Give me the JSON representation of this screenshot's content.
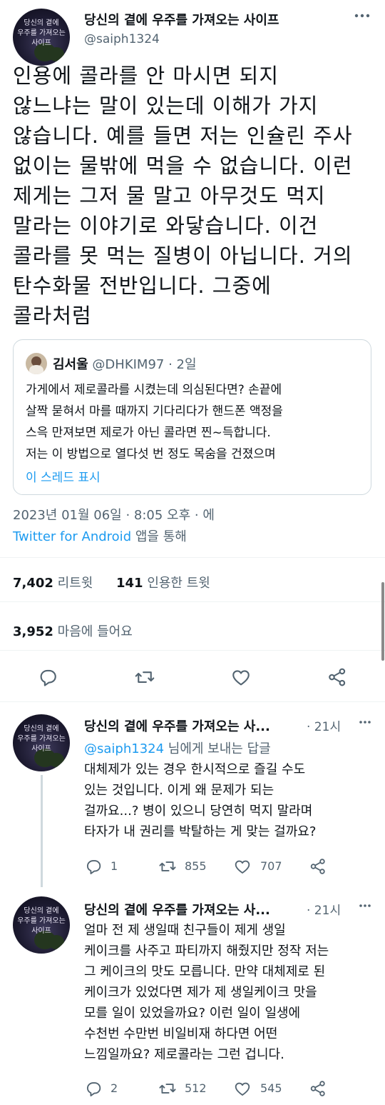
{
  "main_tweet": {
    "display_name": "당신의 곁에 우주를 가져오는 사이프",
    "handle": "@saiph1324",
    "avatar_text": [
      "당신의 곁에",
      "우주를 가져오는",
      "사이프"
    ],
    "lines": [
      "인용에 콜라를 안 마시면 되지",
      "않느냐는 말이 있는데 이해가 가지",
      "않습니다. 예를 들면 저는 인슐린 주사",
      "없이는 물밖에 먹을 수 없습니다. 이런",
      "제게는 그저 물 말고 아무것도 먹지",
      "말라는 이야기로 와닿습니다. 이건",
      "콜라를 못 먹는 질병이 아닙니다. 거의",
      "탄수화물 전반입니다. 그중에",
      "콜라처럼"
    ],
    "quote": {
      "display_name": "김서울",
      "handle": "@DHKIM97",
      "time": "· 2일",
      "lines": [
        "가게에서 제로콜라를 시켰는데 의심된다면? 손끝에",
        "살짝 묻혀서 마를 때까지 기다리다가 핸드폰 액정을",
        "스윽 만져보면 제로가 아닌 콜라면 찐~득합니다.",
        "저는 이 방법으로 열다섯 번 정도 목숨을 건졌으며"
      ],
      "show_thread": "이 스레드 표시"
    },
    "timestamp": "2023년 01월 06일 · 8:05 오후 · 에",
    "source": "Twitter for Android",
    "source_suffix": " 앱을 통해",
    "retweets": "7,402",
    "retweets_label": "리트윗",
    "quotes": "141",
    "quotes_label": "인용한 트윗",
    "likes": "3,952",
    "likes_label": "마음에 들어요"
  },
  "replies": [
    {
      "display_name": "당신의 곁에 우주를 가져오는 사...",
      "time": "· 21시",
      "reply_to_handle": "@saiph1324",
      "reply_to_suffix": " 님에게 보내는 답글",
      "lines": [
        "대체제가 있는 경우 한시적으로 즐길 수도",
        "있는 것입니다. 이게 왜 문제가 되는",
        "걸까요...? 병이 있으니 당연히 먹지 말라며",
        "타자가 내 권리를 박탈하는 게 맞는 걸까요?"
      ],
      "reply_count": "1",
      "retweet_count": "855",
      "like_count": "707"
    },
    {
      "display_name": "당신의 곁에 우주를 가져오는 사...",
      "time": "· 21시",
      "lines": [
        "얼마 전 제 생일때 친구들이 제게 생일",
        "케이크를 사주고 파티까지 해줬지만 정작 저는",
        "그 케이크의 맛도 모릅니다. 만약 대체제로 된",
        "케이크가 있었다면 제가 제 생일케이크 맛을",
        "모를 일이 있었을까요? 이런 일이 일생에",
        "수천번 수만번 비일비재 하다면 어떤",
        "느낌일까요? 제로콜라는 그런 겁니다."
      ],
      "reply_count": "2",
      "retweet_count": "512",
      "like_count": "545"
    }
  ],
  "colors": {
    "text": "#0f1419",
    "secondary": "#536471",
    "accent": "#1d9bf0",
    "border": "#cfd9de"
  }
}
